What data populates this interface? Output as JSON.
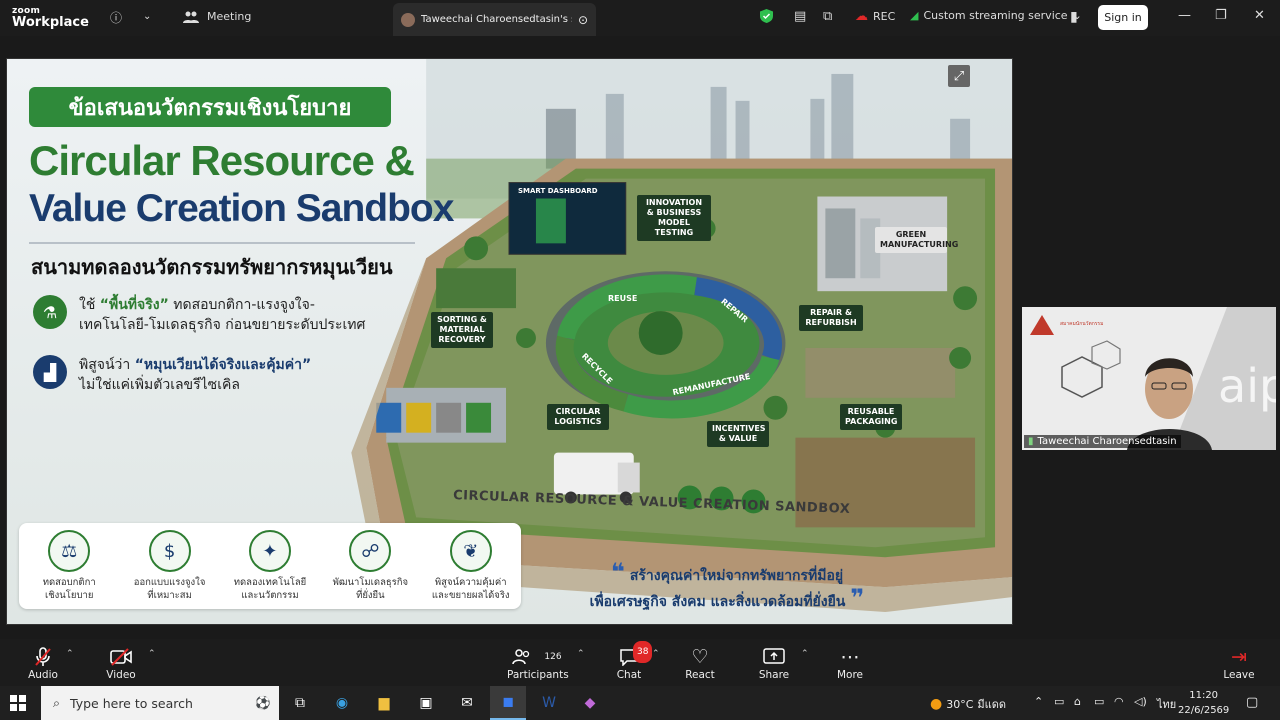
{
  "app": {
    "logo_line1": "zoom",
    "logo_line2": "Workplace"
  },
  "topbar": {
    "meeting_label": "Meeting",
    "share_tab_label": "Taweechai Charoensedtasin's scre",
    "rec_label": "REC",
    "streaming_label": "Custom streaming service",
    "signin_label": "Sign in"
  },
  "slide": {
    "badge_th": "ข้อเสนอนวัตกรรมเชิงนโยบาย",
    "title_line1": "Circular Resource &",
    "title_line2": "Value Creation Sandbox",
    "subtitle_th": "สนามทดลองนวัตกรรมทรัพยากรหมุนเวียน",
    "bullet1_prefix": "ใช้ ",
    "bullet1_highlight": "“พื้นที่จริง”",
    "bullet1_rest": " ทดสอบกติกา-แรงจูงใจ-",
    "bullet1_line2": "เทคโนโลยี-โมเดลธุรกิจ ก่อนขยายระดับประเทศ",
    "bullet2_prefix": "พิสูจน์ว่า ",
    "bullet2_highlight": "“หมุนเวียนได้จริงและคุ้มค่า”",
    "bullet2_line2": "ไม่ใช่แค่เพิ่มตัวเลขรีไซเคิล",
    "cards": [
      {
        "icon": "scale-icon",
        "line1": "ทดสอบกติกา",
        "line2": "เชิงนโยบาย"
      },
      {
        "icon": "money-hand-icon",
        "line1": "ออกแบบแรงจูงใจ",
        "line2": "ที่เหมาะสม"
      },
      {
        "icon": "lightbulb-icon",
        "line1": "ทดลองเทคโนโลยี",
        "line2": "และนวัตกรรม"
      },
      {
        "icon": "network-icon",
        "line1": "พัฒนาโมเดลธุรกิจ",
        "line2": "ที่ยั่งยืน"
      },
      {
        "icon": "leaf-icon",
        "line1": "พิสูจน์ความคุ้มค่า",
        "line2": "และขยายผลได้จริง"
      }
    ],
    "quote_line1": "สร้างคุณค่าใหม่จากทรัพยากรที่มีอยู่",
    "quote_line2": "เพื่อเศรษฐกิจ สังคม และสิ่งแวดล้อมที่ยั่งยืน",
    "banner": "CIRCULAR RESOURCE & VALUE CREATION SANDBOX",
    "map_labels": {
      "dashboard": "SMART DASHBOARD",
      "innovation": "INNOVATION & BUSINESS MODEL TESTING",
      "green": "GREEN MANUFACTURING",
      "sorting": "SORTING & MATERIAL RECOVERY",
      "repair": "REPAIR & REFURBISH",
      "logistics": "CIRCULAR LOGISTICS",
      "incentives": "INCENTIVES & VALUE",
      "packaging": "REUSABLE PACKAGING",
      "reuse": "REUSE",
      "repair_arrow": "REPAIR",
      "recycle": "RECYCLE",
      "remanufacture": "REMANUFACTURE"
    }
  },
  "participant_video": {
    "name": "Taweechai Charoensedtasin"
  },
  "bottombar": {
    "audio": "Audio",
    "video": "Video",
    "participants": "Participants",
    "participant_count": "126",
    "chat": "Chat",
    "chat_badge": "38",
    "react": "React",
    "share": "Share",
    "more": "More",
    "leave": "Leave"
  },
  "taskbar": {
    "search_placeholder": "Type here to search",
    "weather": "30°C",
    "weather_text": "มีแดด",
    "lang": "ไทย",
    "time": "11:20",
    "date": "22/6/2569"
  },
  "colors": {
    "green": "#2e7d32",
    "navy": "#1a3c6e",
    "rec_red": "#e02828"
  }
}
